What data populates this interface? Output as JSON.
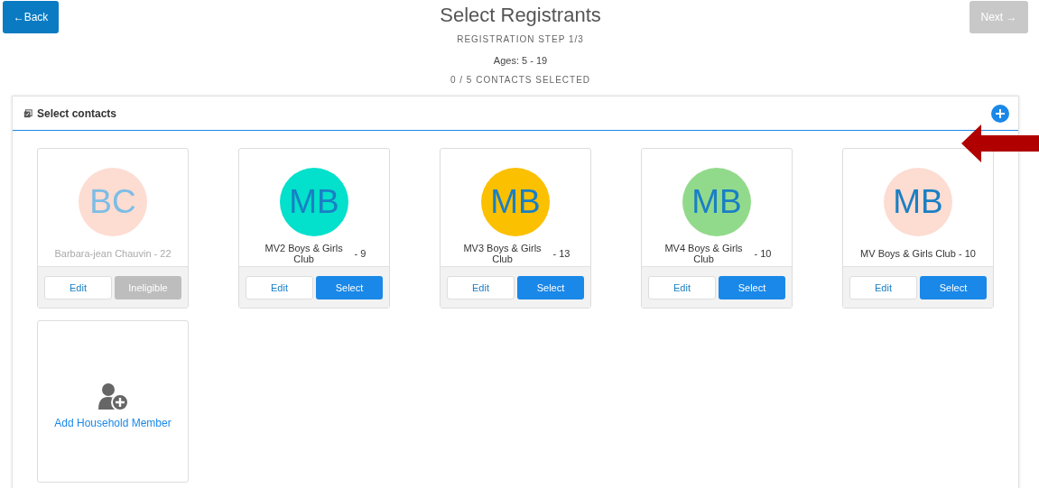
{
  "header": {
    "back": "←Back",
    "title": "Select Registrants",
    "step": "REGISTRATION STEP 1/3",
    "ages": "Ages: 5 - 19",
    "count": "0 / 5 CONTACTS SELECTED",
    "next": "Next →",
    "next_disabled": true
  },
  "panel": {
    "title": "Select contacts",
    "contacts": [
      {
        "initials": "BC",
        "color": "#fddcd2",
        "name_lines": [
          "Barbara-jean Chauvin - 22"
        ],
        "eligible": false,
        "edit": "Edit",
        "action": "Ineligible"
      },
      {
        "initials": "MB",
        "color": "#03e0cb",
        "name_lines": [
          "MV2 Boys & Girls",
          "Club"
        ],
        "age": "- 9",
        "eligible": true,
        "edit": "Edit",
        "action": "Select"
      },
      {
        "initials": "MB",
        "color": "#fbc000",
        "name_lines": [
          "MV3 Boys & Girls",
          "Club"
        ],
        "age": "- 13",
        "eligible": true,
        "edit": "Edit",
        "action": "Select"
      },
      {
        "initials": "MB",
        "color": "#92da8b",
        "name_lines": [
          "MV4 Boys & Girls",
          "Club"
        ],
        "age": "- 10",
        "eligible": true,
        "edit": "Edit",
        "action": "Select"
      },
      {
        "initials": "MB",
        "color": "#fddcd2",
        "name_lines": [
          "MV Boys & Girls Club - 10"
        ],
        "eligible": true,
        "edit": "Edit",
        "action": "Select"
      }
    ],
    "add_member": "Add Household Member"
  }
}
